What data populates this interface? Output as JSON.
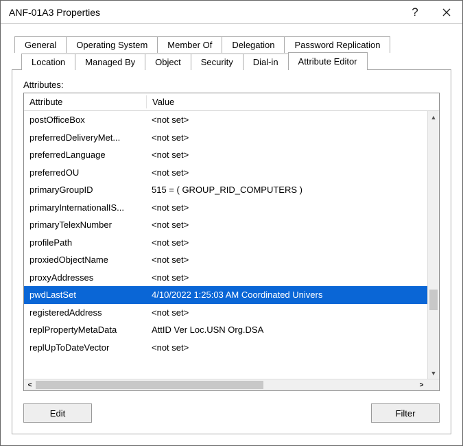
{
  "window": {
    "title": "ANF-01A3 Properties"
  },
  "tabs": {
    "row1": [
      "General",
      "Operating System",
      "Member Of",
      "Delegation",
      "Password Replication"
    ],
    "row2": [
      "Location",
      "Managed By",
      "Object",
      "Security",
      "Dial-in",
      "Attribute Editor"
    ],
    "active": "Attribute Editor"
  },
  "attributes_label": "Attributes:",
  "columns": {
    "attr": "Attribute",
    "val": "Value"
  },
  "rows": [
    {
      "attr": "postOfficeBox",
      "val": "<not set>",
      "selected": false
    },
    {
      "attr": "preferredDeliveryMet...",
      "val": "<not set>",
      "selected": false
    },
    {
      "attr": "preferredLanguage",
      "val": "<not set>",
      "selected": false
    },
    {
      "attr": "preferredOU",
      "val": "<not set>",
      "selected": false
    },
    {
      "attr": "primaryGroupID",
      "val": "515 = ( GROUP_RID_COMPUTERS )",
      "selected": false
    },
    {
      "attr": "primaryInternationalIS...",
      "val": "<not set>",
      "selected": false
    },
    {
      "attr": "primaryTelexNumber",
      "val": "<not set>",
      "selected": false
    },
    {
      "attr": "profilePath",
      "val": "<not set>",
      "selected": false
    },
    {
      "attr": "proxiedObjectName",
      "val": "<not set>",
      "selected": false
    },
    {
      "attr": "proxyAddresses",
      "val": "<not set>",
      "selected": false
    },
    {
      "attr": "pwdLastSet",
      "val": "4/10/2022 1:25:03 AM Coordinated Univers",
      "selected": true
    },
    {
      "attr": "registeredAddress",
      "val": "<not set>",
      "selected": false
    },
    {
      "attr": "replPropertyMetaData",
      "val": "  AttID   Ver        Loc.USN                     Org.DSA",
      "selected": false
    },
    {
      "attr": "replUpToDateVector",
      "val": "<not set>",
      "selected": false
    }
  ],
  "buttons": {
    "edit": "Edit",
    "filter": "Filter"
  }
}
